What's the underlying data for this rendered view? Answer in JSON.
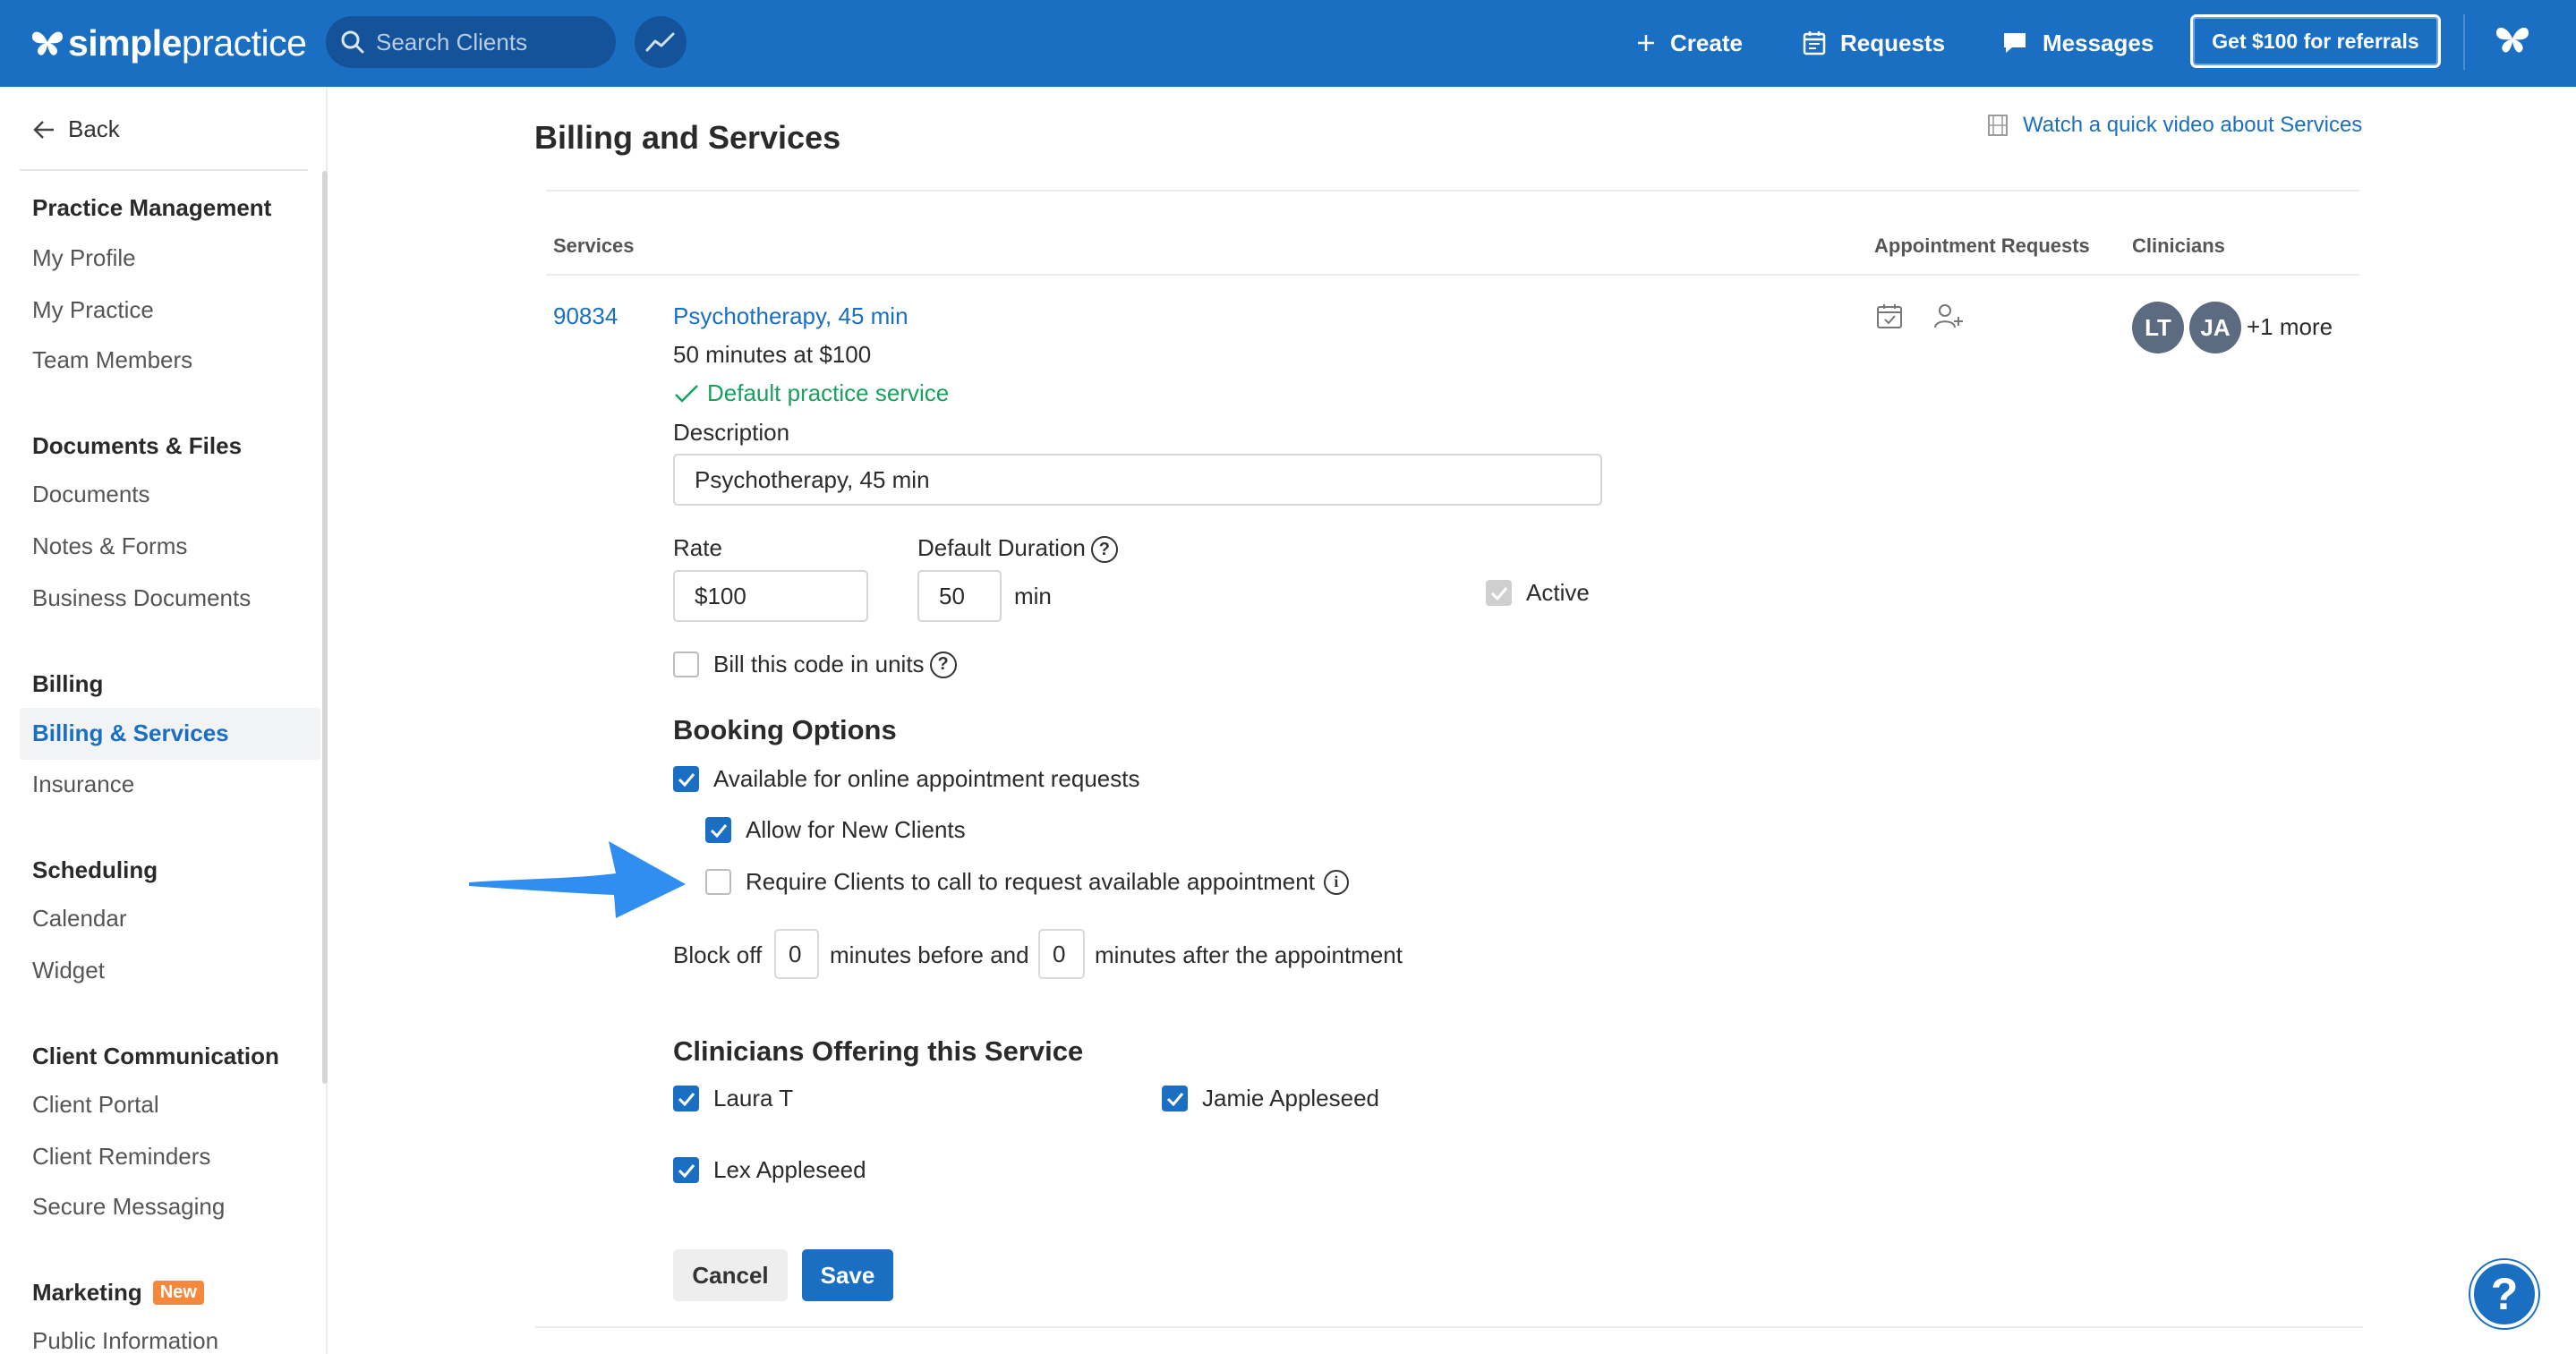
{
  "topbar": {
    "brand_bold": "simple",
    "brand_light": "practice",
    "search_placeholder": "Search Clients",
    "create_label": "Create",
    "requests_label": "Requests",
    "messages_label": "Messages",
    "referral_label": "Get $100 for referrals"
  },
  "sidebar": {
    "back_label": "Back",
    "sections": {
      "practice_management": "Practice Management",
      "my_profile": "My Profile",
      "my_practice": "My Practice",
      "team_members": "Team Members",
      "documents_files": "Documents & Files",
      "documents": "Documents",
      "notes_forms": "Notes & Forms",
      "business_documents": "Business Documents",
      "billing": "Billing",
      "billing_services": "Billing & Services",
      "insurance": "Insurance",
      "scheduling": "Scheduling",
      "calendar": "Calendar",
      "widget": "Widget",
      "client_communication": "Client Communication",
      "client_portal": "Client Portal",
      "client_reminders": "Client Reminders",
      "secure_messaging": "Secure Messaging",
      "marketing": "Marketing",
      "marketing_badge": "New",
      "public_information": "Public Information"
    }
  },
  "main": {
    "title": "Billing and Services",
    "video_link": "Watch a quick video about Services",
    "columns": {
      "services": "Services",
      "appointment_requests": "Appointment Requests",
      "clinicians": "Clinicians"
    },
    "service": {
      "code": "90834",
      "name": "Psychotherapy, 45 min",
      "rate_summary": "50 minutes at $100",
      "default_label": "Default practice service",
      "description_label": "Description",
      "description_value": "Psychotherapy, 45 min",
      "rate_label": "Rate",
      "rate_value": "$100",
      "duration_label": "Default Duration",
      "duration_value": "50",
      "duration_unit": "min",
      "active_label": "Active",
      "active_checked": true,
      "bill_units_label": "Bill this code in units",
      "bill_units_checked": false
    },
    "booking": {
      "heading": "Booking Options",
      "online_requests_label": "Available for online appointment requests",
      "online_requests_checked": true,
      "new_clients_label": "Allow for New Clients",
      "new_clients_checked": true,
      "require_call_label": "Require Clients to call to request available appointment",
      "require_call_checked": false,
      "block_off_prefix": "Block off",
      "block_before_value": "0",
      "block_middle": "minutes before and",
      "block_after_value": "0",
      "block_suffix": "minutes after the appointment"
    },
    "clinicians_section": {
      "heading": "Clinicians Offering this Service",
      "items": [
        {
          "name": "Laura T",
          "checked": true
        },
        {
          "name": "Jamie Appleseed",
          "checked": true
        },
        {
          "name": "Lex Appleseed",
          "checked": true
        }
      ]
    },
    "clinician_avatars": [
      "LT",
      "JA"
    ],
    "more_clinicians": "+1 more",
    "cancel_label": "Cancel",
    "save_label": "Save"
  },
  "help_fab_label": "?",
  "colors": {
    "brand_blue": "#1a6fc2",
    "success_green": "#18a05e",
    "badge_orange": "#f5883a",
    "arrow_blue": "#2f8ef0"
  }
}
